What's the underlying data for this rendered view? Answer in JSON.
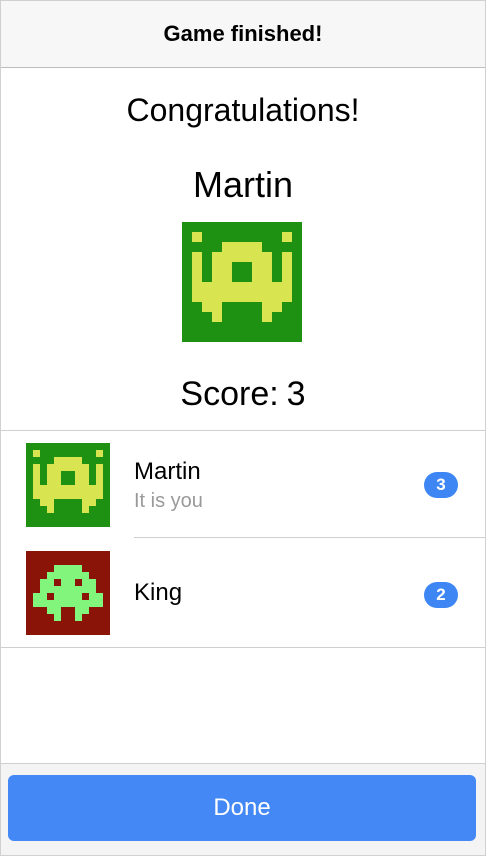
{
  "header": {
    "title": "Game finished!"
  },
  "result": {
    "congrats": "Congratulations!",
    "winner_name": "Martin",
    "score_label": "Score:",
    "score_value": "3"
  },
  "players": [
    {
      "name": "Martin",
      "subtitle": "It is you",
      "score": "3",
      "avatar_icon": "invader-green-icon"
    },
    {
      "name": "King",
      "subtitle": "",
      "score": "2",
      "avatar_icon": "invader-red-icon"
    }
  ],
  "footer": {
    "done_label": "Done"
  },
  "colors": {
    "accent": "#4488f5",
    "badge": "#3d86f4",
    "avatar_green_bg": "#1e9012",
    "avatar_green_fg": "#d9e451",
    "avatar_red_bg": "#8b1408",
    "avatar_red_fg": "#82f57c"
  }
}
